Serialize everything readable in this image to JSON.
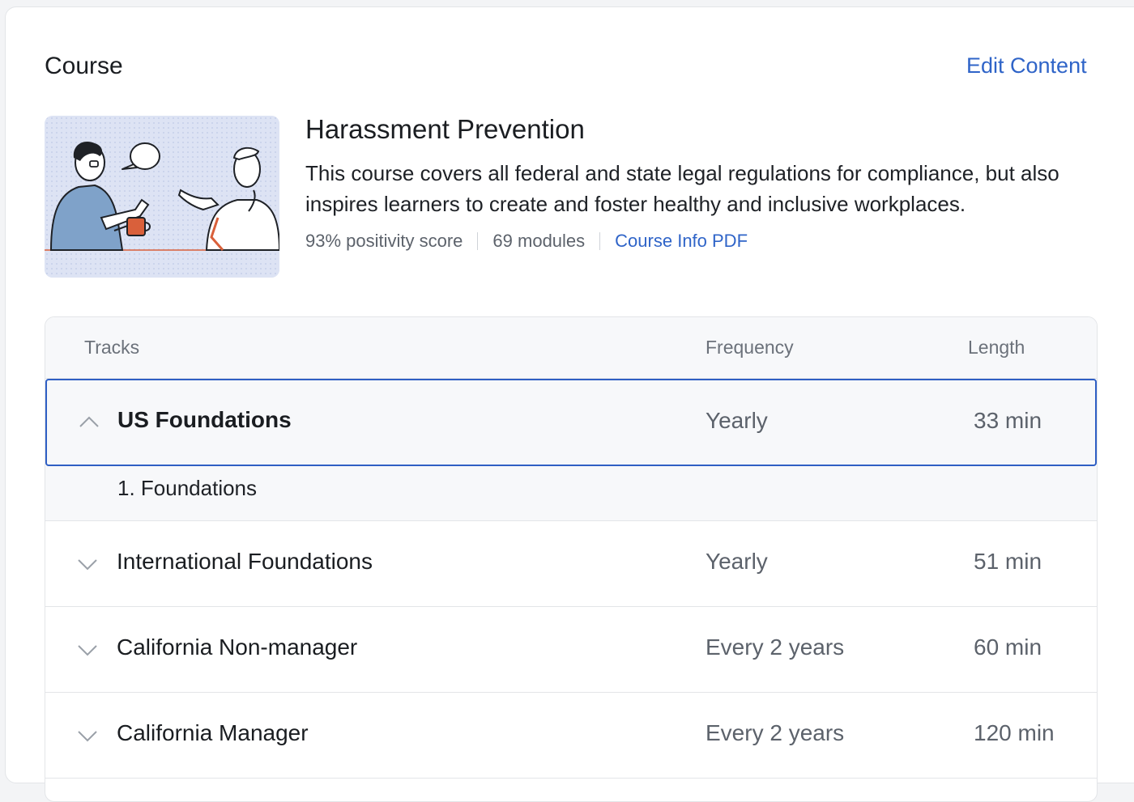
{
  "header": {
    "section_title": "Course",
    "edit_label": "Edit Content"
  },
  "course": {
    "title": "Harassment Prevention",
    "description": "This course covers all federal and state legal regulations for compliance, but also inspires learners to create and foster healthy and inclusive workplaces.",
    "positivity": "93% positivity score",
    "modules": "69 modules",
    "pdf_link": "Course Info PDF",
    "illustration": "two-people-conversation-illustration"
  },
  "table": {
    "headers": {
      "tracks": "Tracks",
      "frequency": "Frequency",
      "length": "Length"
    },
    "rows": [
      {
        "name": "US Foundations",
        "frequency": "Yearly",
        "length": "33 min",
        "expanded": true,
        "items": [
          "1. Foundations"
        ]
      },
      {
        "name": "International Foundations",
        "frequency": "Yearly",
        "length": "51 min",
        "expanded": false
      },
      {
        "name": "California Non-manager",
        "frequency": "Every 2 years",
        "length": "60 min",
        "expanded": false
      },
      {
        "name": "California Manager",
        "frequency": "Every 2 years",
        "length": "120 min",
        "expanded": false
      }
    ]
  },
  "colors": {
    "accent": "#2f64c8",
    "selected_border": "#2f5fc4",
    "muted_text": "#5c626b"
  }
}
